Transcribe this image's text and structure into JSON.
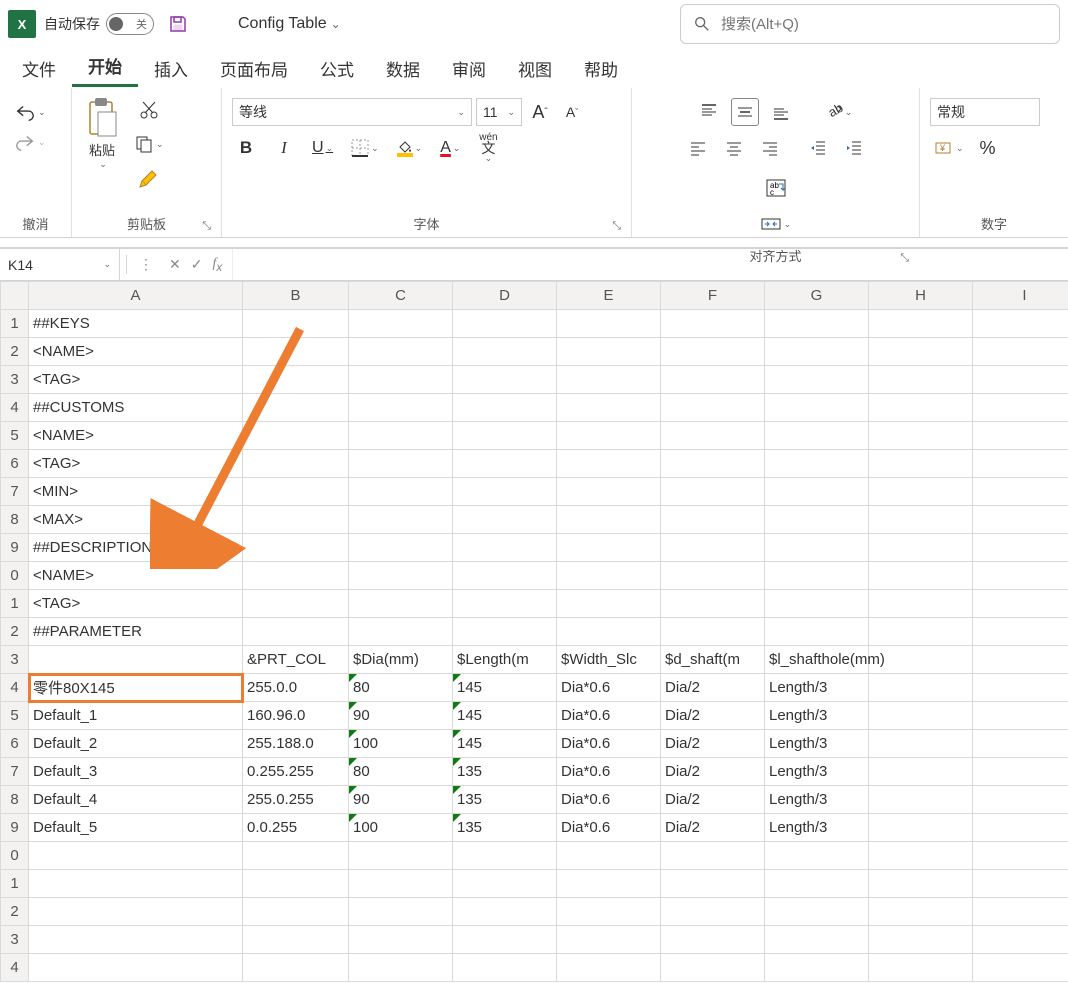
{
  "titlebar": {
    "autosave_label": "自动保存",
    "autosave_off": "关",
    "doc_name": "Config Table",
    "search_placeholder": "搜索(Alt+Q)"
  },
  "tabs": {
    "file": "文件",
    "home": "开始",
    "insert": "插入",
    "layout": "页面布局",
    "formulas": "公式",
    "data": "数据",
    "review": "审阅",
    "view": "视图",
    "help": "帮助"
  },
  "ribbon": {
    "undo_group": "撤消",
    "clipboard_group": "剪贴板",
    "paste_label": "粘贴",
    "font_group": "字体",
    "font_name": "等线",
    "font_size": "11",
    "align_group": "对齐方式",
    "number_group": "数字",
    "number_format": "常规"
  },
  "namebox": "K14",
  "columns": [
    "A",
    "B",
    "C",
    "D",
    "E",
    "F",
    "G",
    "H",
    "I"
  ],
  "row_headers": [
    "1",
    "2",
    "3",
    "4",
    "5",
    "6",
    "7",
    "8",
    "9",
    "0",
    "1",
    "2",
    "3",
    "4",
    "5",
    "6",
    "7",
    "8",
    "9",
    "0",
    "1",
    "2",
    "3",
    "4"
  ],
  "cells": {
    "r1": {
      "A": "##KEYS"
    },
    "r2": {
      "A": "<NAME>"
    },
    "r3": {
      "A": "<TAG>"
    },
    "r4": {
      "A": "##CUSTOMS"
    },
    "r5": {
      "A": "<NAME>"
    },
    "r6": {
      "A": "<TAG>"
    },
    "r7": {
      "A": "<MIN>"
    },
    "r8": {
      "A": "<MAX>"
    },
    "r9": {
      "A": "##DESCRIPTIONS"
    },
    "r10": {
      "A": "<NAME>"
    },
    "r11": {
      "A": "<TAG>"
    },
    "r12": {
      "A": "##PARAMETER"
    },
    "r13": {
      "B": "&PRT_COL",
      "C": "$Dia(mm)",
      "D": "$Length(m",
      "E": "$Width_Slc",
      "F": "$d_shaft(m",
      "G": "$l_shafthole(mm)"
    },
    "r14": {
      "A": "零件80X145",
      "B": "255.0.0",
      "C": "80",
      "D": "145",
      "E": "Dia*0.6",
      "F": "Dia/2",
      "G": "Length/3"
    },
    "r15": {
      "A": "Default_1",
      "B": "160.96.0",
      "C": "90",
      "D": "145",
      "E": "Dia*0.6",
      "F": "Dia/2",
      "G": "Length/3"
    },
    "r16": {
      "A": "Default_2",
      "B": "255.188.0",
      "C": "100",
      "D": "145",
      "E": "Dia*0.6",
      "F": "Dia/2",
      "G": "Length/3"
    },
    "r17": {
      "A": "Default_3",
      "B": "0.255.255",
      "C": "80",
      "D": "135",
      "E": "Dia*0.6",
      "F": "Dia/2",
      "G": "Length/3"
    },
    "r18": {
      "A": "Default_4",
      "B": "255.0.255",
      "C": "90",
      "D": "135",
      "E": "Dia*0.6",
      "F": "Dia/2",
      "G": "Length/3"
    },
    "r19": {
      "A": "Default_5",
      "B": "0.0.255",
      "C": "100",
      "D": "135",
      "E": "Dia*0.6",
      "F": "Dia/2",
      "G": "Length/3"
    }
  }
}
